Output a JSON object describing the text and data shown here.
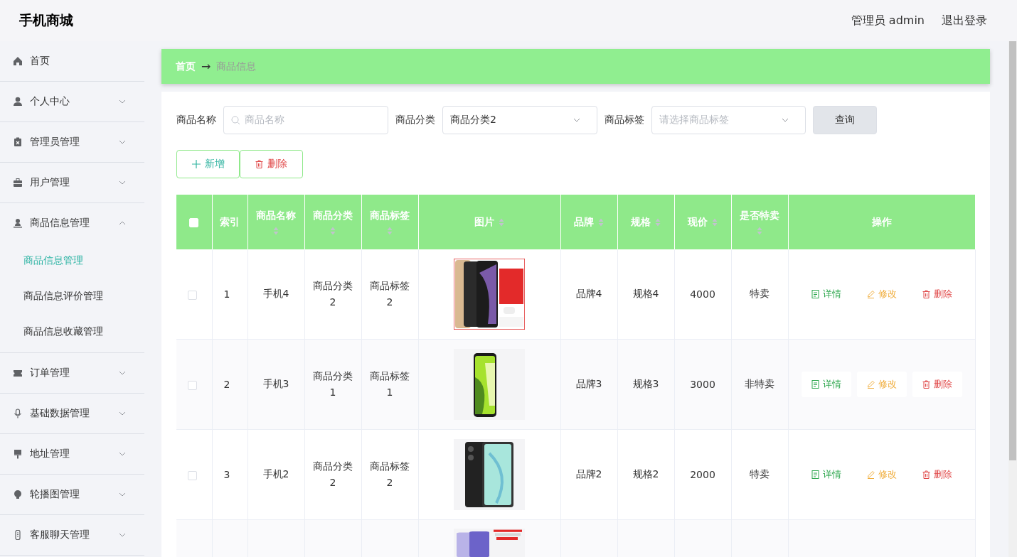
{
  "app": {
    "title": "手机商城"
  },
  "header": {
    "user": "管理员 admin",
    "logout": "退出登录"
  },
  "sidebar": {
    "items": [
      {
        "label": "首页",
        "kind": "link",
        "expanded": false
      },
      {
        "label": "个人中心",
        "kind": "submenu",
        "expanded": false
      },
      {
        "label": "管理员管理",
        "kind": "submenu",
        "expanded": false
      },
      {
        "label": "用户管理",
        "kind": "submenu",
        "expanded": false
      },
      {
        "label": "商品信息管理",
        "kind": "submenu",
        "expanded": true,
        "children": [
          {
            "label": "商品信息管理",
            "selected": true
          },
          {
            "label": "商品信息评价管理",
            "selected": false
          },
          {
            "label": "商品信息收藏管理",
            "selected": false
          }
        ]
      },
      {
        "label": "订单管理",
        "kind": "submenu",
        "expanded": false
      },
      {
        "label": "基础数据管理",
        "kind": "submenu",
        "expanded": false
      },
      {
        "label": "地址管理",
        "kind": "submenu",
        "expanded": false
      },
      {
        "label": "轮播图管理",
        "kind": "submenu",
        "expanded": false
      },
      {
        "label": "客服聊天管理",
        "kind": "submenu",
        "expanded": false
      }
    ]
  },
  "breadcrumb": {
    "items": [
      "首页",
      "商品信息"
    ],
    "separator": "→"
  },
  "filters": [
    {
      "label": "商品名称",
      "kind": "search",
      "placeholder": "商品名称"
    },
    {
      "label": "商品分类",
      "kind": "select",
      "value": "商品分类2"
    },
    {
      "label": "商品标签",
      "kind": "select",
      "placeholder": "请选择商品标签"
    }
  ],
  "query_button": "查询",
  "actions": [
    {
      "label": "新增",
      "kind": "add"
    },
    {
      "label": "删除",
      "kind": "delete"
    }
  ],
  "table": {
    "select_all": {
      "checked": false
    },
    "columns": [
      {
        "label": "索引",
        "sortable": false
      },
      {
        "label": "商品名称",
        "sortable": true
      },
      {
        "label": "商品分类",
        "sortable": true
      },
      {
        "label": "商品标签",
        "sortable": true
      },
      {
        "label": "图片",
        "sortable": true
      },
      {
        "label": "品牌",
        "sortable": true
      },
      {
        "label": "规格",
        "sortable": true
      },
      {
        "label": "现价",
        "sortable": true
      },
      {
        "label": "是否特卖",
        "sortable": true
      },
      {
        "label": "操作",
        "sortable": false
      }
    ],
    "rows": [
      {
        "checked": false,
        "index": "1",
        "name": "手机4",
        "category": "商品分类2",
        "tag": "商品标签2",
        "picture": {
          "kind": "picture"
        },
        "brand": "品牌4",
        "spec": "规格4",
        "price": "4000",
        "special": "特卖",
        "actions": [
          {
            "label": "详情",
            "kind": "view"
          },
          {
            "label": "修改",
            "kind": "edit"
          },
          {
            "label": "删除",
            "kind": "delete"
          }
        ]
      },
      {
        "checked": false,
        "index": "2",
        "name": "手机3",
        "category": "商品分类1",
        "tag": "商品标签1",
        "picture": {
          "kind": "picture"
        },
        "brand": "品牌3",
        "spec": "规格3",
        "price": "3000",
        "special": "非特卖",
        "actions": [
          {
            "label": "详情",
            "kind": "view"
          },
          {
            "label": "修改",
            "kind": "edit"
          },
          {
            "label": "删除",
            "kind": "delete"
          }
        ]
      },
      {
        "checked": false,
        "index": "3",
        "name": "手机2",
        "category": "商品分类2",
        "tag": "商品标签2",
        "picture": {
          "kind": "picture"
        },
        "brand": "品牌2",
        "spec": "规格2",
        "price": "2000",
        "special": "特卖",
        "actions": [
          {
            "label": "详情",
            "kind": "view"
          },
          {
            "label": "修改",
            "kind": "edit"
          },
          {
            "label": "删除",
            "kind": "delete"
          }
        ]
      },
      {
        "picture": {
          "kind": "picture"
        }
      }
    ]
  }
}
